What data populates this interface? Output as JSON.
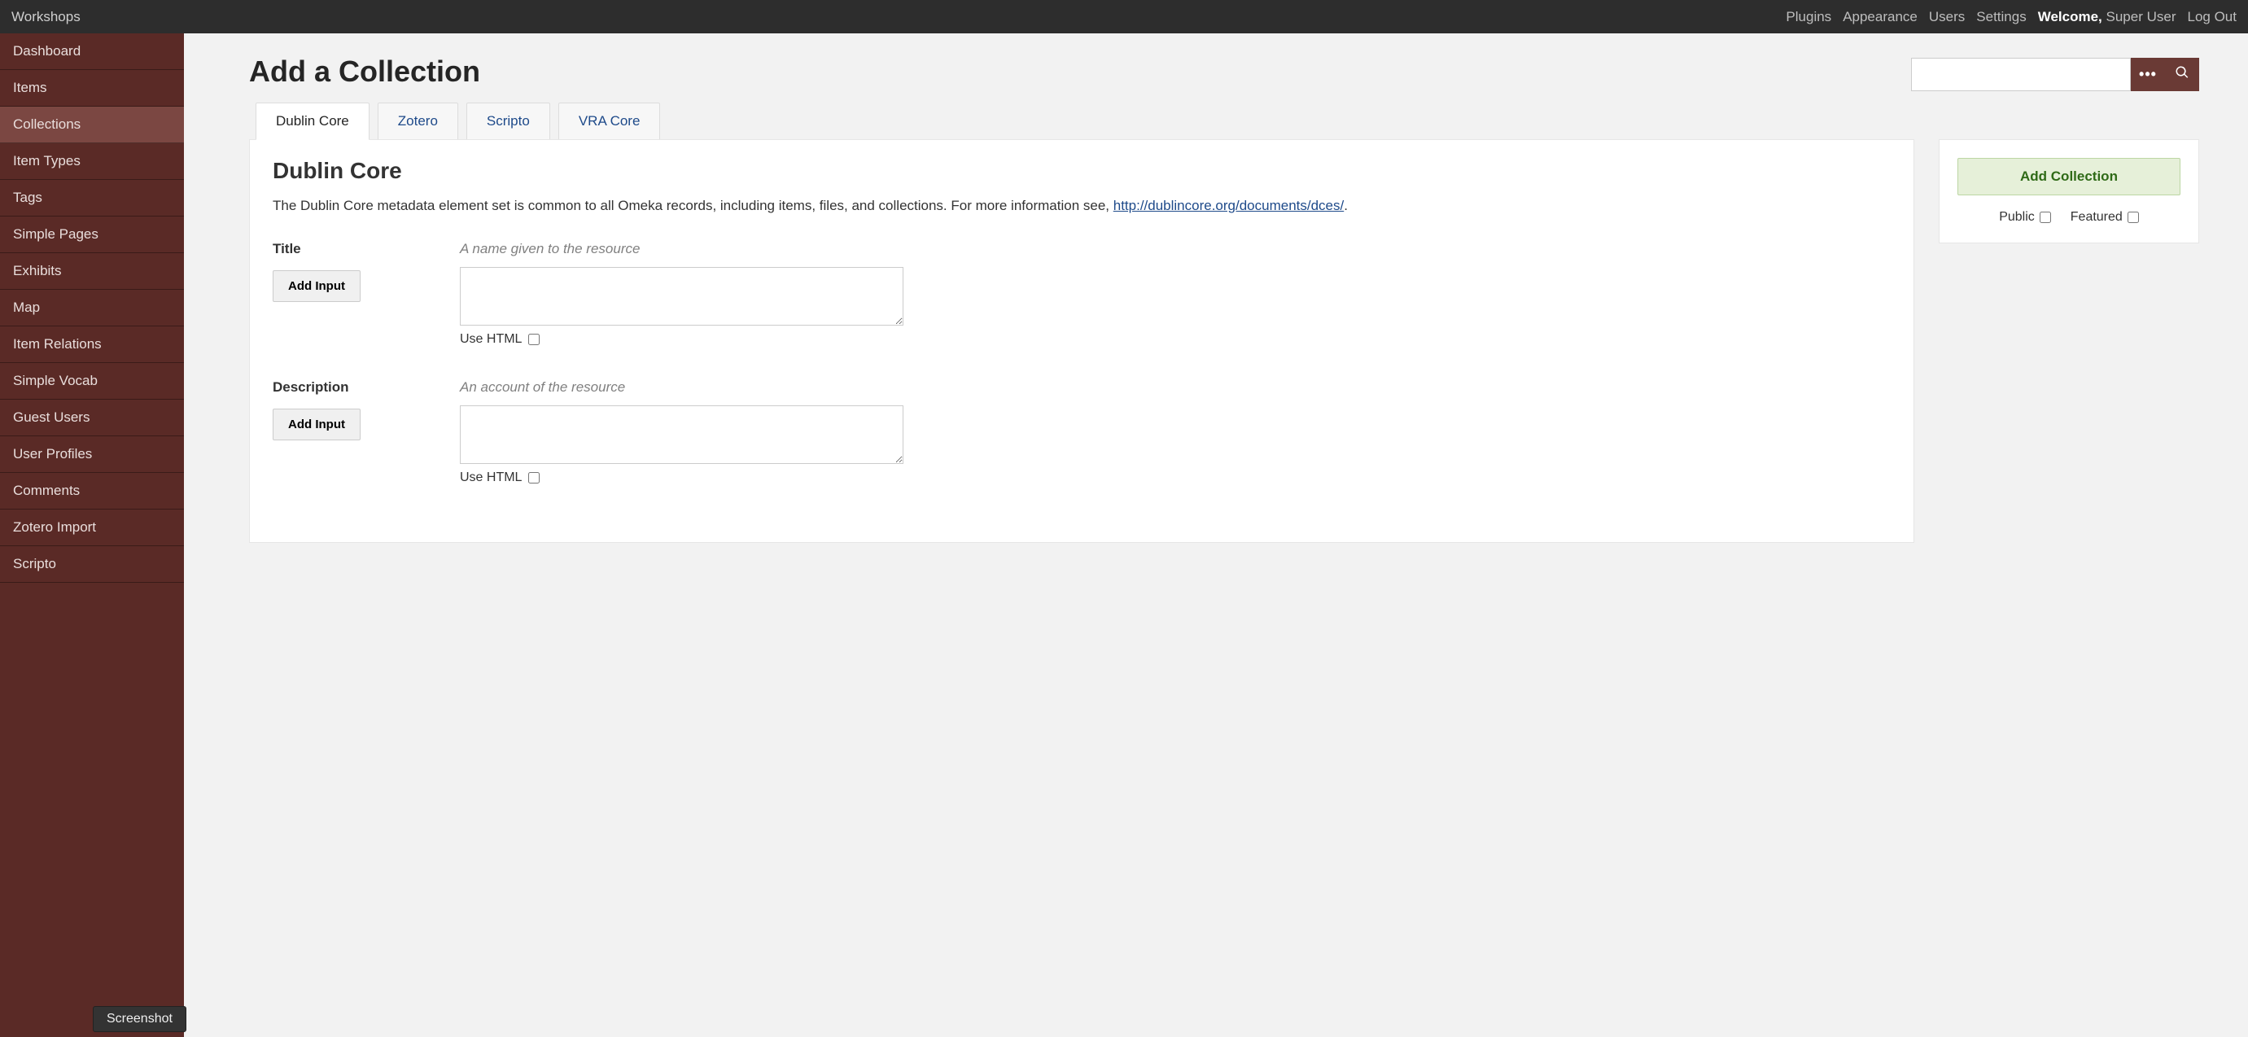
{
  "topbar": {
    "site_title": "Workshops",
    "nav": {
      "plugins": "Plugins",
      "appearance": "Appearance",
      "users": "Users",
      "settings": "Settings"
    },
    "welcome_prefix": "Welcome,",
    "welcome_user": "Super User",
    "logout": "Log Out"
  },
  "sidebar": {
    "items": [
      "Dashboard",
      "Items",
      "Collections",
      "Item Types",
      "Tags",
      "Simple Pages",
      "Exhibits",
      "Map",
      "Item Relations",
      "Simple Vocab",
      "Guest Users",
      "User Profiles",
      "Comments",
      "Zotero Import",
      "Scripto"
    ],
    "active_index": 2
  },
  "page": {
    "title": "Add a Collection"
  },
  "tabs": {
    "items": [
      "Dublin Core",
      "Zotero",
      "Scripto",
      "VRA Core"
    ],
    "active_index": 0
  },
  "dc": {
    "heading": "Dublin Core",
    "desc_prefix": "The Dublin Core metadata element set is common to all Omeka records, including items, files, and collections. For more information see, ",
    "desc_link_text": "http://dublincore.org/documents/dces/",
    "desc_suffix": "."
  },
  "fields": [
    {
      "label": "Title",
      "hint": "A name given to the resource",
      "add_input": "Add Input",
      "use_html": "Use HTML"
    },
    {
      "label": "Description",
      "hint": "An account of the resource",
      "add_input": "Add Input",
      "use_html": "Use HTML"
    }
  ],
  "rightbox": {
    "add_button": "Add Collection",
    "public_label": "Public",
    "featured_label": "Featured"
  },
  "pill": {
    "label": "Screenshot"
  }
}
